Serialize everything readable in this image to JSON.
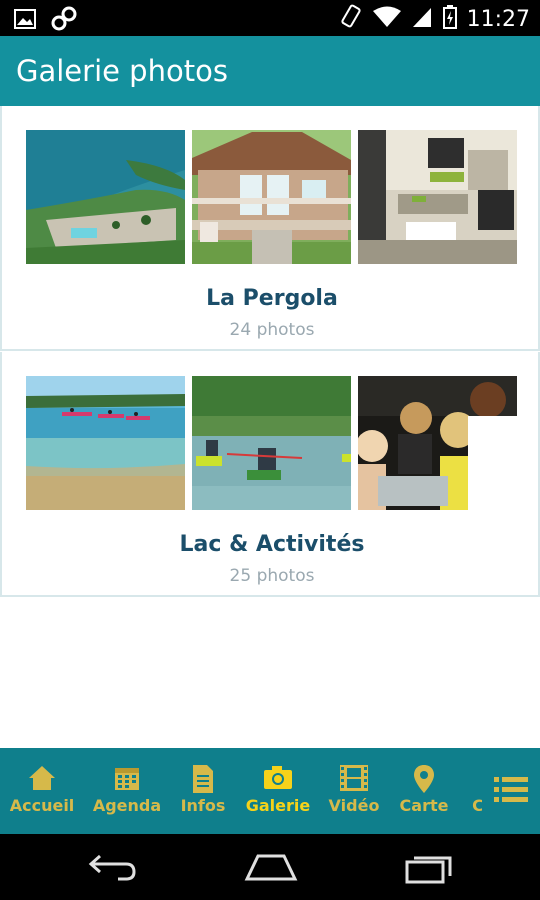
{
  "status_bar": {
    "time": "11:27",
    "icons": [
      "image-notification-icon",
      "infinity-icon",
      "rotate-icon",
      "wifi-icon",
      "signal-icon",
      "battery-icon"
    ]
  },
  "app_bar": {
    "title": "Galerie photos"
  },
  "albums": [
    {
      "title": "La Pergola",
      "count": "24 photos",
      "photos": [
        "aerial-lake-campsite",
        "wooden-chalet",
        "chalet-interior"
      ]
    },
    {
      "title": "Lac & Activités",
      "count": "25 photos",
      "photos": [
        "lake-kayakers",
        "kayak-group",
        "children-activity"
      ]
    }
  ],
  "bottom_nav": {
    "items": [
      {
        "label": "Accueil",
        "icon": "home-icon"
      },
      {
        "label": "Agenda",
        "icon": "calendar-icon"
      },
      {
        "label": "Infos",
        "icon": "document-icon"
      },
      {
        "label": "Galerie",
        "icon": "camera-icon",
        "active": true
      },
      {
        "label": "Vidéo",
        "icon": "film-icon"
      },
      {
        "label": "Carte",
        "icon": "map-pin-icon"
      },
      {
        "label": "C",
        "icon": ""
      }
    ],
    "more_icon": "menu-list-icon"
  },
  "colors": {
    "app_bar": "#14919e",
    "nav_bg": "#0f7f8c",
    "nav_label": "#d6b94a",
    "nav_active": "#f5d21a",
    "album_title": "#1b4e6a",
    "album_count": "#9aa8b0"
  },
  "android_nav": [
    "back-icon",
    "home-outline-icon",
    "recents-icon"
  ]
}
